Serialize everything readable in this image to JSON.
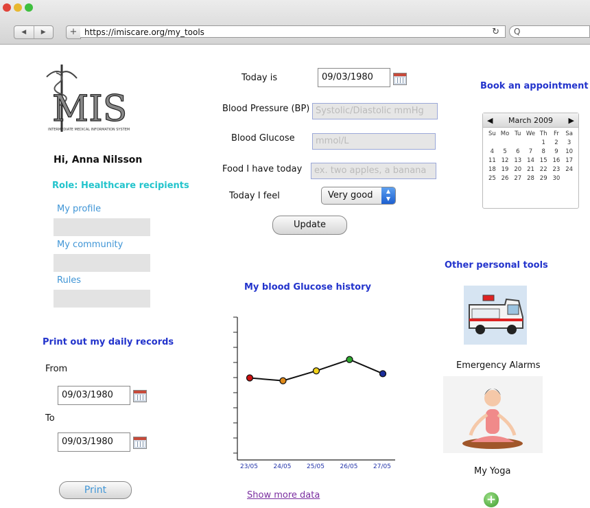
{
  "browser": {
    "url": "https://imiscare.org/my_tools",
    "search_placeholder": "Q"
  },
  "logo": {
    "text": "MIS",
    "subtitle": "INTERMEDIATE MEDICAL INFORMATION SYSTEM"
  },
  "user": {
    "greeting": "Hi, Anna Nilsson",
    "role": "Role: Healthcare recipients"
  },
  "nav": {
    "profile": "My profile",
    "community": "My community",
    "rules": "Rules"
  },
  "print": {
    "heading": "Print out my daily records",
    "from_label": "From",
    "from_value": "09/03/1980",
    "to_label": "To",
    "to_value": "09/03/1980",
    "button": "Print"
  },
  "form": {
    "today_label": "Today is",
    "today_value": "09/03/1980",
    "bp_label": "Blood Pressure (BP)",
    "bp_placeholder": "Systolic/Diastolic mmHg",
    "glucose_label": "Blood Glucose",
    "glucose_placeholder": "mmol/L",
    "food_label": "Food I have today",
    "food_placeholder": "ex. two apples, a banana",
    "feel_label": "Today I feel",
    "feel_value": "Very good",
    "update_button": "Update"
  },
  "chart_data": {
    "type": "line",
    "title": "My blood Glucose history",
    "categories": [
      "23/05",
      "24/05",
      "25/05",
      "26/05",
      "27/05"
    ],
    "values": [
      5.8,
      5.6,
      6.3,
      7.1,
      6.1
    ],
    "point_colors": [
      "#cc1111",
      "#e08a1a",
      "#f2d21a",
      "#2faa2f",
      "#1a2d9a"
    ],
    "ylim": [
      0,
      10
    ],
    "link": "Show more data"
  },
  "appointment": {
    "heading": "Book an appointment",
    "month": "March 2009",
    "weekdays": [
      "Su",
      "Mo",
      "Tu",
      "We",
      "Th",
      "Fr",
      "Sa"
    ],
    "days": [
      "",
      "",
      "",
      "",
      "1",
      "2",
      "3",
      "4",
      "5",
      "6",
      "7",
      "8",
      "9",
      "10",
      "11",
      "12",
      "13",
      "14",
      "15",
      "16",
      "17",
      "18",
      "19",
      "20",
      "21",
      "22",
      "23",
      "24",
      "25",
      "26",
      "27",
      "28",
      "29",
      "30",
      "",
      ""
    ]
  },
  "tools": {
    "heading": "Other personal tools",
    "emergency": "Emergency Alarms",
    "yoga": "My Yoga"
  },
  "colors": {
    "heading_blue": "#2233cc",
    "role_cyan": "#22c4cc",
    "link_blue": "#3f95d6"
  }
}
